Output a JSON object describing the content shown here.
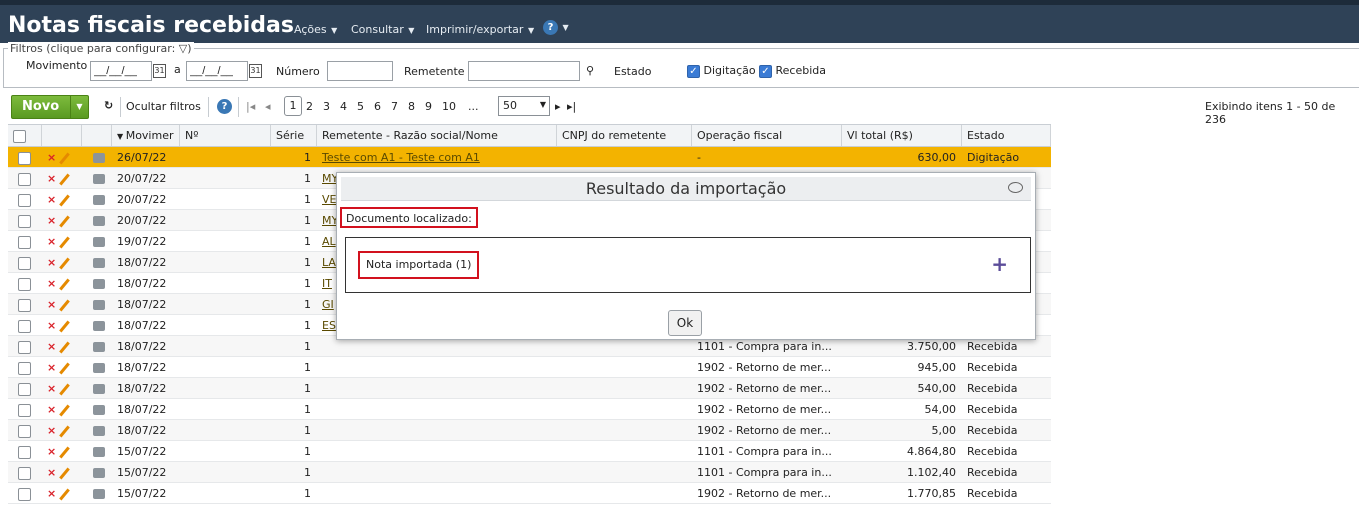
{
  "header": {
    "title": "Notas fiscais recebidas",
    "menu": {
      "acoes": "Ações",
      "consultar": "Consultar",
      "imprimir": "Imprimir/exportar",
      "help": "?"
    }
  },
  "filters": {
    "legend": "Filtros (clique para configurar: ",
    "legend_close": ")",
    "movimento_label": "Movimento",
    "date_from": "__/__/__",
    "date_sep": "a",
    "date_to": "__/__/__",
    "numero_label": "Número",
    "numero_value": "",
    "remetente_label": "Remetente",
    "remetente_value": "",
    "estado_label": "Estado",
    "estado_digitacao": "Digitação",
    "estado_recebida": "Recebida"
  },
  "toolbar": {
    "novo_label": "Novo",
    "ocultar_filtros": "Ocultar filtros",
    "pages": [
      "2",
      "3",
      "4",
      "5",
      "6",
      "7",
      "8",
      "9",
      "10",
      "..."
    ],
    "current_page": "1",
    "page_size": "50",
    "status": "Exibindo itens 1 - 50 de 236"
  },
  "grid": {
    "headers": [
      "",
      "",
      "",
      "Movimer",
      "Nº",
      "Série",
      "Remetente - Razão social/Nome",
      "CNPJ do remetente",
      "Operação fiscal",
      "Vl total (R$)",
      "Estado"
    ],
    "rows": [
      {
        "movimento": "26/07/22",
        "serie": "1",
        "remetente": "Teste com A1 - Teste com A1",
        "operacao": "-",
        "total": "630,00",
        "estado": "Digitação"
      },
      {
        "movimento": "20/07/22",
        "serie": "1",
        "remetente": "MY",
        "operacao": "",
        "total": "",
        "estado": ""
      },
      {
        "movimento": "20/07/22",
        "serie": "1",
        "remetente": "VE",
        "operacao": "",
        "total": "",
        "estado": ""
      },
      {
        "movimento": "20/07/22",
        "serie": "1",
        "remetente": "MY",
        "operacao": "",
        "total": "",
        "estado": ""
      },
      {
        "movimento": "19/07/22",
        "serie": "1",
        "remetente": "AL",
        "operacao": "",
        "total": "",
        "estado": ""
      },
      {
        "movimento": "18/07/22",
        "serie": "1",
        "remetente": "LA",
        "operacao": "",
        "total": "",
        "estado": ""
      },
      {
        "movimento": "18/07/22",
        "serie": "1",
        "remetente": "IT",
        "operacao": "",
        "total": "",
        "estado": ""
      },
      {
        "movimento": "18/07/22",
        "serie": "1",
        "remetente": "GI",
        "operacao": "",
        "total": "",
        "estado": ""
      },
      {
        "movimento": "18/07/22",
        "serie": "1",
        "remetente": "ES",
        "operacao": "",
        "total": "",
        "estado": ""
      },
      {
        "movimento": "18/07/22",
        "serie": "1",
        "remetente": "",
        "operacao": "1101 - Compra para in...",
        "total": "3.750,00",
        "estado": "Recebida"
      },
      {
        "movimento": "18/07/22",
        "serie": "1",
        "remetente": "",
        "operacao": "1902 - Retorno de mer...",
        "total": "945,00",
        "estado": "Recebida"
      },
      {
        "movimento": "18/07/22",
        "serie": "1",
        "remetente": "",
        "operacao": "1902 - Retorno de mer...",
        "total": "540,00",
        "estado": "Recebida"
      },
      {
        "movimento": "18/07/22",
        "serie": "1",
        "remetente": "",
        "operacao": "1902 - Retorno de mer...",
        "total": "54,00",
        "estado": "Recebida"
      },
      {
        "movimento": "18/07/22",
        "serie": "1",
        "remetente": "",
        "operacao": "1902 - Retorno de mer...",
        "total": "5,00",
        "estado": "Recebida"
      },
      {
        "movimento": "15/07/22",
        "serie": "1",
        "remetente": "",
        "operacao": "1101 - Compra para in...",
        "total": "4.864,80",
        "estado": "Recebida"
      },
      {
        "movimento": "15/07/22",
        "serie": "1",
        "remetente": "",
        "operacao": "1101 - Compra para in...",
        "total": "1.102,40",
        "estado": "Recebida"
      },
      {
        "movimento": "15/07/22",
        "serie": "1",
        "remetente": "",
        "operacao": "1902 - Retorno de mer...",
        "total": "1.770,85",
        "estado": "Recebida"
      }
    ]
  },
  "modal": {
    "title": "Resultado da importação",
    "doc_label": "Documento localizado:",
    "nota_label": "Nota importada (1)",
    "ok_label": "Ok"
  },
  "colors": {
    "header_bg": "#2f4257",
    "highlight_row": "#f3b300",
    "novo_green": "#6aaa2e",
    "annotation_red": "#d2111e"
  }
}
